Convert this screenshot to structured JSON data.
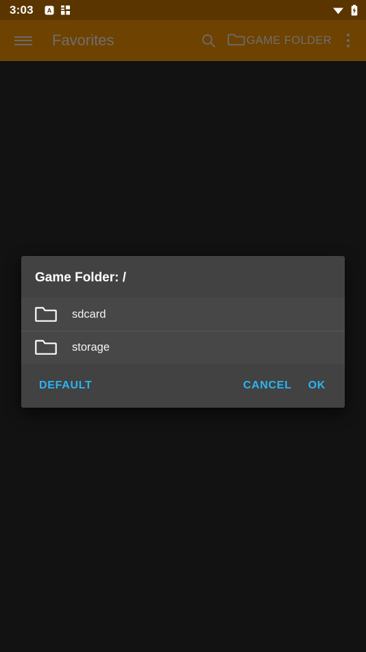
{
  "status_bar": {
    "clock": "3:03",
    "left_icons": [
      {
        "name": "app-badge-a-icon",
        "glyph": "A"
      },
      {
        "name": "grid-squares-icon",
        "glyph": "▦"
      }
    ],
    "right_icons": [
      {
        "name": "wifi-icon"
      },
      {
        "name": "battery-charging-icon"
      }
    ],
    "background_color": "#5a3500"
  },
  "toolbar": {
    "title": "Favorites",
    "nav_icon": "hamburger-menu-icon",
    "search_icon": "search-icon",
    "game_folder_label": "GAME FOLDER",
    "game_folder_icon": "folder-outline-icon",
    "overflow_icon": "more-vertical-icon",
    "background_color": "#6e4200",
    "dimmed_text_color": "#6f6f6f"
  },
  "dialog": {
    "title": "Game Folder: /",
    "background_color": "#424242",
    "list_background_color": "#474747",
    "items": [
      {
        "icon": "folder-icon",
        "label": "sdcard"
      },
      {
        "icon": "folder-icon",
        "label": "storage"
      }
    ],
    "buttons": {
      "default_label": "DEFAULT",
      "cancel_label": "CANCEL",
      "ok_label": "OK",
      "accent_color": "#29b6f6"
    }
  },
  "background": {
    "content_color": "#121212"
  }
}
